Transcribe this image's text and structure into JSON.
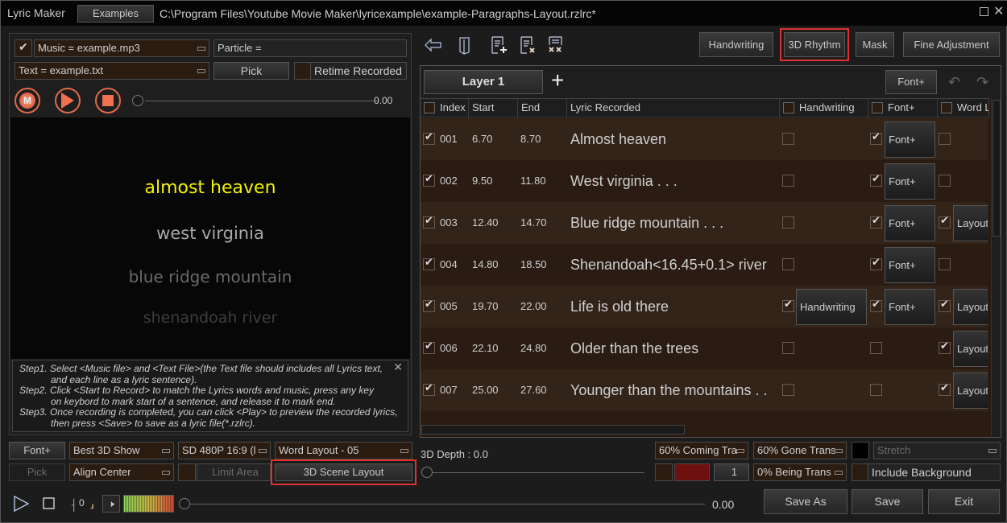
{
  "window": {
    "app_title": "Lyric Maker",
    "examples_label": "Examples",
    "file_path": "C:\\Program Files\\Youtube Movie Maker\\lyricexample\\example-Paragraphs-Layout.rzlrc*",
    "maximize_icon": "maximize-icon",
    "close_icon": "close-icon"
  },
  "left": {
    "music_checked": true,
    "music_field": "Music = example.mp3",
    "particle_field": "Particle =",
    "text_field": "Text = example.txt",
    "pick_label": "Pick",
    "retime_label": "Retime Recorded",
    "retime_checked": false,
    "record_buttons": [
      "M",
      "play",
      "stop"
    ],
    "time": "0.00",
    "preview_lines": [
      {
        "text": "almost heaven",
        "color": "#f2f200"
      },
      {
        "text": "west virginia",
        "color": "#a8a8a8"
      },
      {
        "text": "blue ridge mountain",
        "color": "#6a6a6a"
      },
      {
        "text": "shenandoah river",
        "color": "#3e3e3e"
      }
    ],
    "help": {
      "step1a": "Step1. Select <Music file> and <Text File>(the Text file should includes all Lyrics text,",
      "step1b": "and each line as a lyric sentence).",
      "step2a": "Step2. Click <Start to Record> to match the Lyrics words and music, press any key",
      "step2b": "on keybord to mark start of a sentence, and release it to mark end.",
      "step3a": "Step3. Once recording is completed, you can click <Play> to preview the recorded lyrics,",
      "step3b": "then press <Save> to save as a lyric file(*.rzlrc).",
      "close": "✕"
    }
  },
  "toolbar": {
    "icons": [
      "back-arrow-icon",
      "open-door-icon",
      "add-line-icon",
      "delete-line-icon",
      "delete-all-icon"
    ],
    "tabs": [
      {
        "label": "Handwriting",
        "highlighted": false
      },
      {
        "label": "3D Rhythm",
        "highlighted": true
      },
      {
        "label": "Mask",
        "highlighted": false
      },
      {
        "label": "Fine Adjustment",
        "highlighted": false
      }
    ]
  },
  "grid": {
    "layer_label": "Layer 1",
    "add_layer": "+",
    "font_plus_label": "Font+",
    "undo_icon": "↶",
    "redo_icon": "↷",
    "headers": {
      "index": "Index",
      "start": "Start",
      "end": "End",
      "lyric": "Lyric Recorded",
      "handwriting": "Handwriting",
      "font": "Font+",
      "word_layout": "Word L"
    },
    "rows": [
      {
        "checked": true,
        "index": "001",
        "start": "6.70",
        "end": "8.70",
        "lyric": "Almost heaven",
        "hw": false,
        "hw_btn": "",
        "font": true,
        "font_btn": "Font+",
        "wl": false,
        "wl_btn": ""
      },
      {
        "checked": true,
        "index": "002",
        "start": "9.50",
        "end": "11.80",
        "lyric": "West virginia . . .",
        "hw": false,
        "hw_btn": "",
        "font": true,
        "font_btn": "Font+",
        "wl": false,
        "wl_btn": ""
      },
      {
        "checked": true,
        "index": "003",
        "start": "12.40",
        "end": "14.70",
        "lyric": "Blue ridge mountain . . .",
        "hw": false,
        "hw_btn": "",
        "font": true,
        "font_btn": "Font+",
        "wl": true,
        "wl_btn": "Layout"
      },
      {
        "checked": true,
        "index": "004",
        "start": "14.80",
        "end": "18.50",
        "lyric": "Shenandoah<16.45+0.1> river",
        "hw": false,
        "hw_btn": "",
        "font": true,
        "font_btn": "Font+",
        "wl": false,
        "wl_btn": ""
      },
      {
        "checked": true,
        "index": "005",
        "start": "19.70",
        "end": "22.00",
        "lyric": "Life is old there",
        "hw": true,
        "hw_btn": "Handwriting",
        "font": true,
        "font_btn": "Font+",
        "wl": true,
        "wl_btn": "Layout"
      },
      {
        "checked": true,
        "index": "006",
        "start": "22.10",
        "end": "24.80",
        "lyric": "Older than the trees",
        "hw": false,
        "hw_btn": "",
        "font": false,
        "font_btn": "",
        "wl": true,
        "wl_btn": "Layout"
      },
      {
        "checked": true,
        "index": "007",
        "start": "25.00",
        "end": "27.60",
        "lyric": "Younger than the mountains . .",
        "hw": false,
        "hw_btn": "",
        "font": false,
        "font_btn": "",
        "wl": true,
        "wl_btn": "Layout"
      }
    ]
  },
  "bottom": {
    "font_plus": "Font+",
    "show_style": "Best 3D Show",
    "resolution": "SD 480P 16:9 (l",
    "word_layout": "Word Layout - 05",
    "pick": "Pick",
    "align": "Align Center",
    "limit_area": "Limit Area",
    "scene_layout": "3D Scene Layout",
    "depth_label": "3D Depth : 0.0",
    "coming_trans": "60% Coming Tra",
    "gone_trans": "60% Gone Trans",
    "stretch": "Stretch",
    "being_trans": "0% Being Trans",
    "include_bg": "Include Background",
    "color_value": "1",
    "swatch_red": "#6e1010",
    "swatch_black": "#000000",
    "counter": "0",
    "play_time": "0.00",
    "save_as": "Save As",
    "save": "Save",
    "exit": "Exit"
  }
}
